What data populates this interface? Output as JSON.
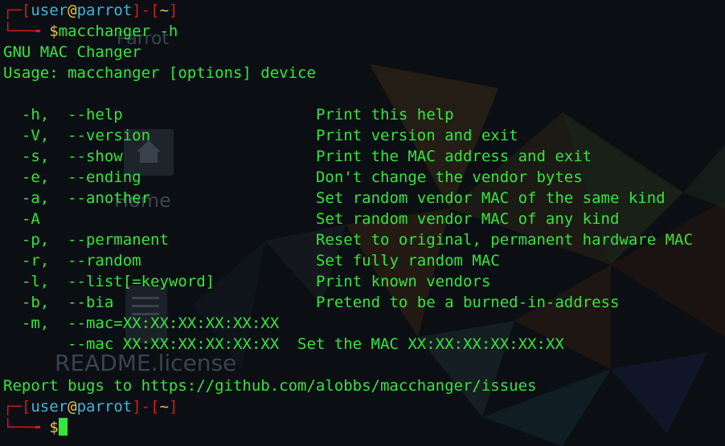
{
  "prompt": {
    "lbr": "[",
    "user": "user",
    "at": "@",
    "host": "parrot",
    "rbr": "]",
    "dash": "-",
    "lbr2": "[",
    "cwd": "~",
    "rbr2": "]",
    "connector_top": "┌─",
    "connector_bottom": "└──╼ ",
    "symbol": "$"
  },
  "command": "macchanger -h",
  "output": {
    "title": "GNU MAC Changer",
    "usage": "Usage: macchanger [options] device",
    "options": [
      {
        "flags": "  -h,  --help                     ",
        "desc": "Print this help"
      },
      {
        "flags": "  -V,  --version                  ",
        "desc": "Print version and exit"
      },
      {
        "flags": "  -s,  --show                     ",
        "desc": "Print the MAC address and exit"
      },
      {
        "flags": "  -e,  --ending                   ",
        "desc": "Don't change the vendor bytes"
      },
      {
        "flags": "  -a,  --another                  ",
        "desc": "Set random vendor MAC of the same kind"
      },
      {
        "flags": "  -A                              ",
        "desc": "Set random vendor MAC of any kind"
      },
      {
        "flags": "  -p,  --permanent                ",
        "desc": "Reset to original, permanent hardware MAC"
      },
      {
        "flags": "  -r,  --random                   ",
        "desc": "Set fully random MAC"
      },
      {
        "flags": "  -l,  --list[=keyword]           ",
        "desc": "Print known vendors"
      },
      {
        "flags": "  -b,  --bia                      ",
        "desc": "Pretend to be a burned-in-address"
      },
      {
        "flags": "  -m,  --mac=XX:XX:XX:XX:XX:XX",
        "desc": ""
      },
      {
        "flags": "       --mac XX:XX:XX:XX:XX:XX  ",
        "desc": "Set the MAC XX:XX:XX:XX:XX:XX"
      }
    ],
    "report": "Report bugs to https://github.com/alobbs/macchanger/issues"
  },
  "desktop": {
    "home_label": "Home",
    "readme_label": "README.license",
    "parrot_label": "Parrot"
  },
  "colors": {
    "text_green": "#35e53a",
    "prompt_red": "#d11b1b",
    "user_cyan": "#3fb6d6",
    "dollar_yellow": "#e6c440",
    "background": "#0b0f14"
  },
  "icons": [
    "home-folder-icon",
    "text-file-icon",
    "cursor-block"
  ]
}
